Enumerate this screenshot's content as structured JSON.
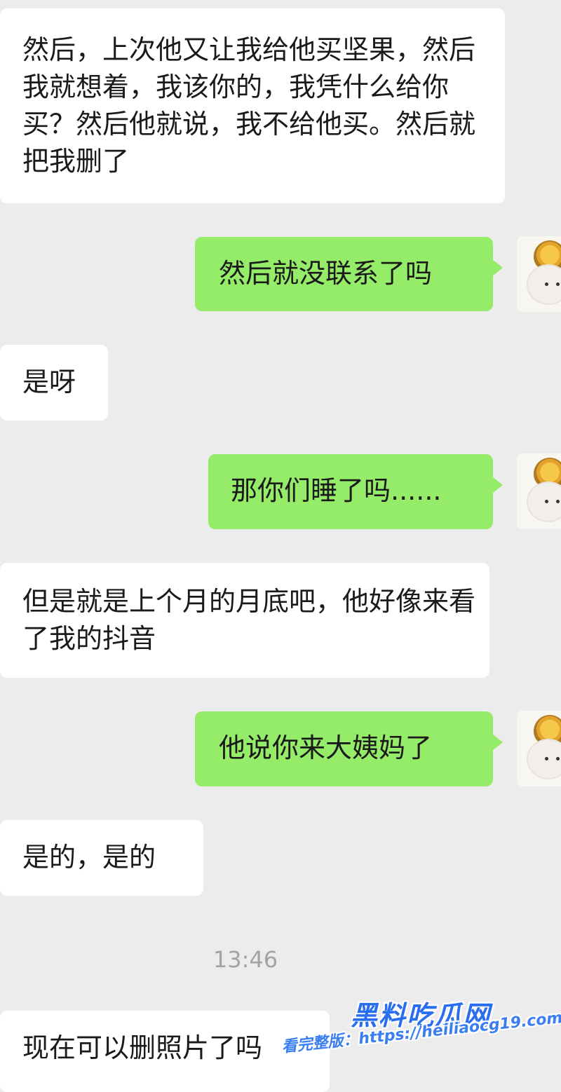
{
  "messages": [
    {
      "side": "left",
      "text": "然后，上次他又让我给他买坚果，然后我就想着，我该你的，我凭什么给你买？然后他就说，我不给他买。然后就把我删了"
    },
    {
      "side": "right",
      "text": "然后就没联系了吗"
    },
    {
      "side": "left",
      "text": "是呀"
    },
    {
      "side": "right",
      "text": "那你们睡了吗......"
    },
    {
      "side": "left",
      "text": "但是就是上个月的月底吧，他好像来看了我的抖音"
    },
    {
      "side": "right",
      "text": "他说你来大姨妈了"
    },
    {
      "side": "left",
      "text": "是的，是的"
    },
    {
      "side": "left",
      "text": "现在可以删照片了吗"
    }
  ],
  "timestamp": "13:46",
  "watermark": {
    "title": "黑料吃瓜网",
    "line": "看完整版：https://heiliaocg19.com"
  }
}
